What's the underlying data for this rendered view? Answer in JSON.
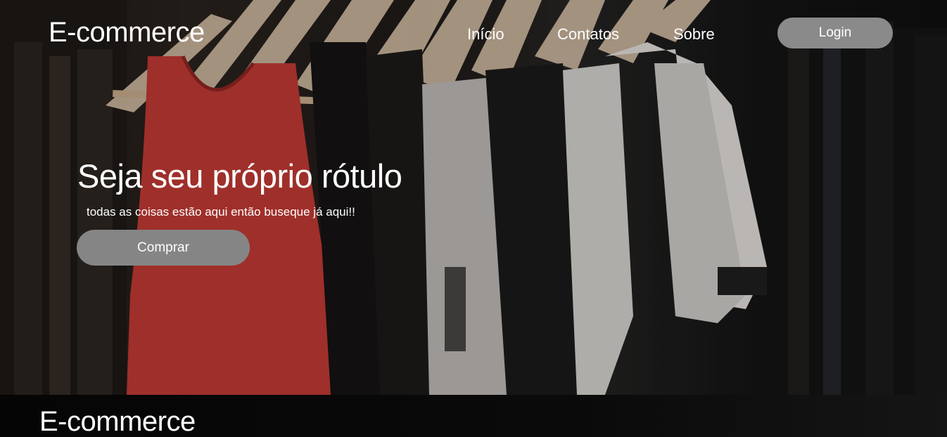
{
  "header": {
    "logo": "E-commerce",
    "nav": {
      "inicio": "Início",
      "contatos": "Contatos",
      "sobre": "Sobre"
    },
    "login_label": "Login"
  },
  "hero": {
    "headline": "Seja seu próprio rótulo",
    "subline": "todas as coisas estão aqui então buseque já aqui!!",
    "buy_label": "Comprar"
  },
  "footer": {
    "logo": "E-commerce"
  },
  "colors": {
    "button_bg": "#858585",
    "text": "#ffffff",
    "footer_bg": "#050505"
  }
}
